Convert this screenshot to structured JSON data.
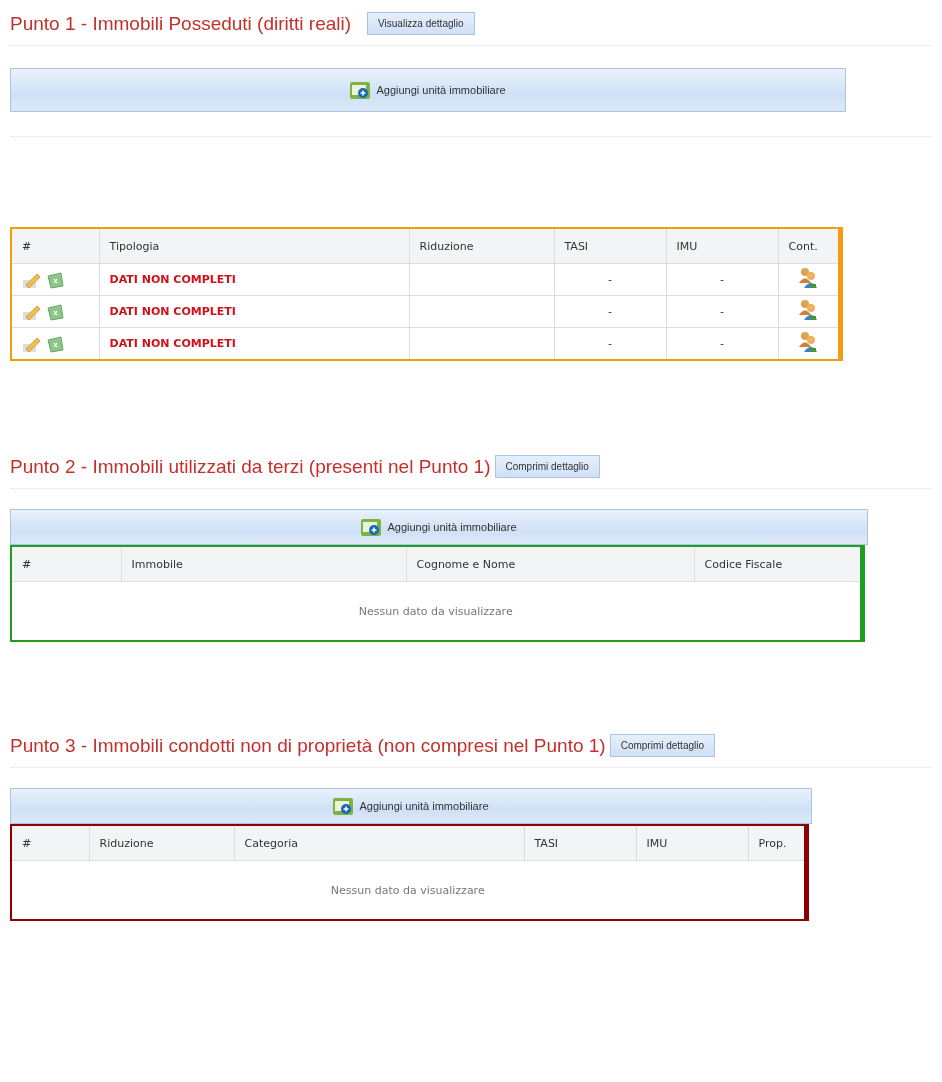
{
  "sections": [
    {
      "title": "Punto 1 - Immobili Posseduti (diritti reali)",
      "toggle": "Visualizza dettaglio",
      "kind": "detached",
      "add_label": "Aggiungi unità immobiliare",
      "color": "#f39c12",
      "columns": [
        "#",
        "Tipologia",
        "Riduzione",
        "TASI",
        "IMU",
        "Cont."
      ],
      "rows": [
        {
          "tipologia": "DATI NON COMPLETI",
          "tasi": "-",
          "imu": "-"
        },
        {
          "tipologia": "DATI NON COMPLETI",
          "tasi": "-",
          "imu": "-"
        },
        {
          "tipologia": "DATI NON COMPLETI",
          "tasi": "-",
          "imu": "-"
        }
      ]
    },
    {
      "title": "Punto 2 - Immobili utilizzati da terzi (presenti nel Punto 1)",
      "toggle": "Comprimi dettaglio",
      "kind": "attached",
      "add_label": "Aggiungi unità immobiliare",
      "color": "#1e9e1e",
      "columns": [
        "#",
        "Immobile",
        "Cognome e Nome",
        "Codice Fiscale"
      ],
      "empty": "Nessun dato da visualizzare"
    },
    {
      "title": "Punto 3 - Immobili condotti non di proprietà (non compresi nel Punto 1)",
      "toggle": "Comprimi dettaglio",
      "kind": "attached",
      "add_label": "Aggiungi unità immobiliare",
      "color": "#8b0000",
      "columns": [
        "#",
        "Riduzione",
        "Categoria",
        "TASI",
        "IMU",
        "Prop."
      ],
      "empty": "Nessun dato da visualizzare"
    }
  ]
}
